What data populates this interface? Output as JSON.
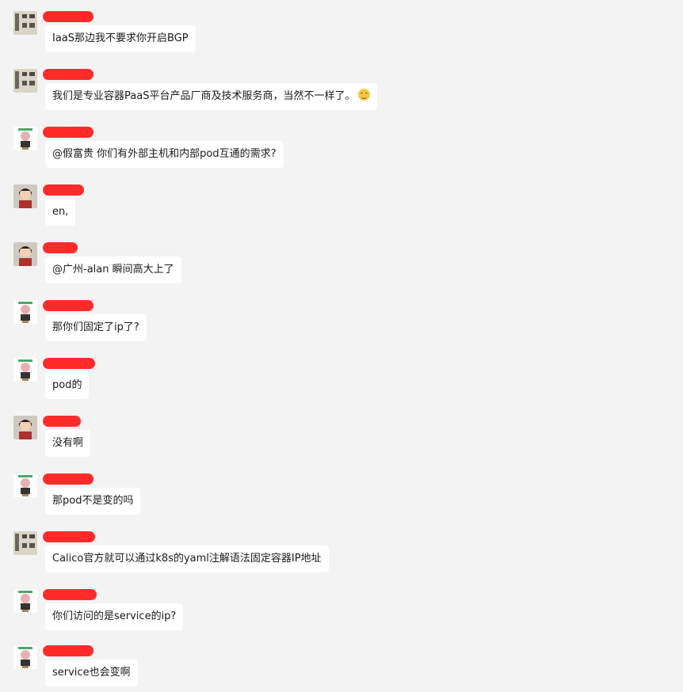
{
  "messages": [
    {
      "sender": "calligraphy",
      "text": "IaaS那边我不要求你开启BGP"
    },
    {
      "sender": "calligraphy",
      "text": "我们是专业容器PaaS平台产品厂商及技术服务商，当然不一样了。",
      "emoji": "smile-emoji"
    },
    {
      "sender": "cartoon",
      "text": "@假富贵 你们有外部主机和内部pod互通的需求?"
    },
    {
      "sender": "photo",
      "text": "en,"
    },
    {
      "sender": "photo",
      "text": "@广州-alan 瞬间高大上了"
    },
    {
      "sender": "cartoon",
      "text": "那你们固定了ip了?"
    },
    {
      "sender": "cartoon",
      "text": "pod的"
    },
    {
      "sender": "photo",
      "text": "没有啊"
    },
    {
      "sender": "cartoon",
      "text": "那pod不是变的吗"
    },
    {
      "sender": "calligraphy",
      "text": "Calico官方就可以通过k8s的yaml注解语法固定容器IP地址"
    },
    {
      "sender": "cartoon",
      "text": "你们访问的是service的ip?"
    },
    {
      "sender": "cartoon",
      "text": "service也会变啊"
    }
  ],
  "colors": {
    "background": "#f3f3f3",
    "bubble": "#ffffff",
    "redaction": "#ff2b2b"
  }
}
